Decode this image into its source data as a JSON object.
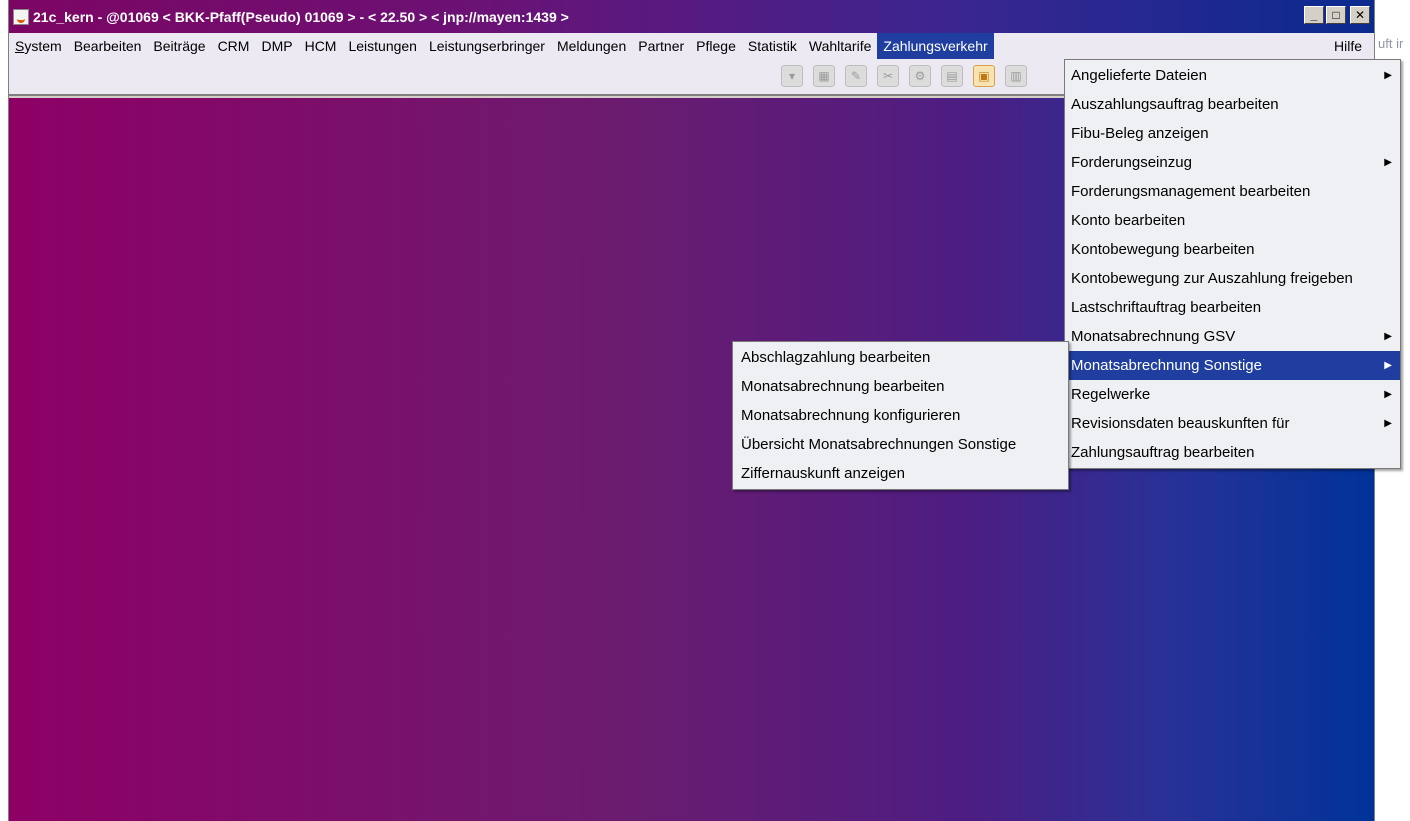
{
  "window": {
    "title": "21c_kern - @01069 < BKK-Pfaff(Pseudo) 01069 > - < 22.50 > < jnp://mayen:1439 >",
    "icon": "java-cup-icon",
    "controls": [
      "minimize",
      "maximize",
      "close"
    ]
  },
  "outside_text": "uft ir",
  "menubar": {
    "items": [
      {
        "label": "System"
      },
      {
        "label": "Bearbeiten"
      },
      {
        "label": "Beiträge"
      },
      {
        "label": "CRM"
      },
      {
        "label": "DMP"
      },
      {
        "label": "HCM"
      },
      {
        "label": "Leistungen"
      },
      {
        "label": "Leistungserbringer"
      },
      {
        "label": "Meldungen"
      },
      {
        "label": "Partner"
      },
      {
        "label": "Pflege"
      },
      {
        "label": "Statistik"
      },
      {
        "label": "Wahltarife"
      },
      {
        "label": "Zahlungsverkehr"
      }
    ],
    "help": "Hilfe",
    "active": "Zahlungsverkehr"
  },
  "toolbar": {
    "icons": [
      "dropdown-icon",
      "disk-icon",
      "wrench-icon",
      "tool-icon",
      "gear-icon",
      "notepad-icon",
      "clipboard-icon",
      "document-icon"
    ]
  },
  "menu_zahlungsverkehr": {
    "items": [
      {
        "label": "Angelieferte Dateien",
        "submenu": true
      },
      {
        "label": "Auszahlungsauftrag bearbeiten",
        "submenu": false
      },
      {
        "label": "Fibu-Beleg anzeigen",
        "submenu": false
      },
      {
        "label": "Forderungseinzug",
        "submenu": true
      },
      {
        "label": "Forderungsmanagement bearbeiten",
        "submenu": false
      },
      {
        "label": "Konto bearbeiten",
        "submenu": false
      },
      {
        "label": "Kontobewegung bearbeiten",
        "submenu": false
      },
      {
        "label": "Kontobewegung zur Auszahlung freigeben",
        "submenu": false
      },
      {
        "label": "Lastschriftauftrag bearbeiten",
        "submenu": false
      },
      {
        "label": "Monatsabrechnung GSV",
        "submenu": true
      },
      {
        "label": "Monatsabrechnung Sonstige",
        "submenu": true,
        "active": true
      },
      {
        "label": "Regelwerke",
        "submenu": true
      },
      {
        "label": "Revisionsdaten beauskunften für",
        "submenu": true
      },
      {
        "label": "Zahlungsauftrag bearbeiten",
        "submenu": false
      }
    ]
  },
  "menu_monatsabrechnung_sonstige": {
    "items": [
      {
        "label": "Abschlagzahlung bearbeiten"
      },
      {
        "label": "Monatsabrechnung bearbeiten"
      },
      {
        "label": "Monatsabrechnung konfigurieren"
      },
      {
        "label": "Übersicht Monatsabrechnungen Sonstige"
      },
      {
        "label": "Ziffernauskunft anzeigen"
      }
    ]
  },
  "colors": {
    "menu_highlight": "#1f3e9f",
    "desktop_gradient_start": "#8e0065",
    "desktop_gradient_end": "#003399",
    "titlebar_start": "#7d0564",
    "titlebar_end": "#0a2a8f"
  }
}
